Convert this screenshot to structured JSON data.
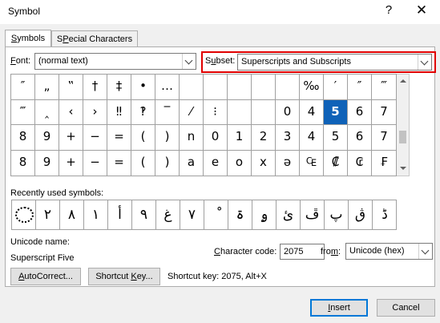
{
  "window": {
    "title": "Symbol",
    "help": "?",
    "close": "✕"
  },
  "tabs": [
    {
      "label": "Symbols",
      "key": "S",
      "rest": "ymbols"
    },
    {
      "label": "Special Characters",
      "key": "P",
      "pre": "S",
      "rest": "ecial Characters"
    }
  ],
  "font": {
    "label_key": "F",
    "label_rest": "ont:",
    "value": "(normal text)"
  },
  "subset": {
    "label_key": "u",
    "label_pre": "S",
    "label_rest": "bset:",
    "value": "Superscripts and Subscripts"
  },
  "symbol_grid": [
    [
      "″",
      "„",
      "‟",
      "†",
      "‡",
      "•",
      "…",
      "",
      "",
      "",
      "",
      "",
      "‰",
      "′",
      "″",
      "‴"
    ],
    [
      "‴",
      "‸",
      "‹",
      "›",
      "‼",
      "‽",
      "‾",
      "⁄",
      "⁝",
      "",
      "",
      "0",
      "4",
      "5",
      "6",
      "7"
    ],
    [
      "8",
      "9",
      "+",
      "−",
      "=",
      "(",
      ")",
      "n",
      "0",
      "1",
      "2",
      "3",
      "4",
      "5",
      "6",
      "7"
    ],
    [
      "8",
      "9",
      "+",
      "−",
      "=",
      "(",
      ")",
      "a",
      "e",
      "o",
      "x",
      "ə",
      "₠",
      "₡",
      "₢",
      "₣"
    ]
  ],
  "selected_cell": {
    "row": 1,
    "col": 13
  },
  "recently_used": {
    "label": "Recently used symbols:",
    "symbols": [
      "",
      "٢",
      "٨",
      "١",
      "أ",
      "٩",
      "غ",
      "٧",
      "ْ",
      "ۃ",
      "ۄ",
      "ئ",
      "ڦ",
      "پ",
      "ڨ",
      "ڈ"
    ]
  },
  "unicode": {
    "label": "Unicode name:",
    "name": "Superscript Five"
  },
  "char_code": {
    "label_key": "C",
    "label_rest": "haracter code:",
    "value": "2075"
  },
  "from": {
    "label_key": "m",
    "label_pre": "fro",
    "label_rest": ":",
    "value": "Unicode (hex)"
  },
  "buttons": {
    "autocorrect_key": "A",
    "autocorrect_rest": "utoCorrect...",
    "shortcut_pre": "Shortcut ",
    "shortcut_key": "K",
    "shortcut_rest": "ey...",
    "insert_key": "I",
    "insert_rest": "nsert",
    "cancel": "Cancel"
  },
  "shortcut_info": "Shortcut key: 2075, Alt+X"
}
